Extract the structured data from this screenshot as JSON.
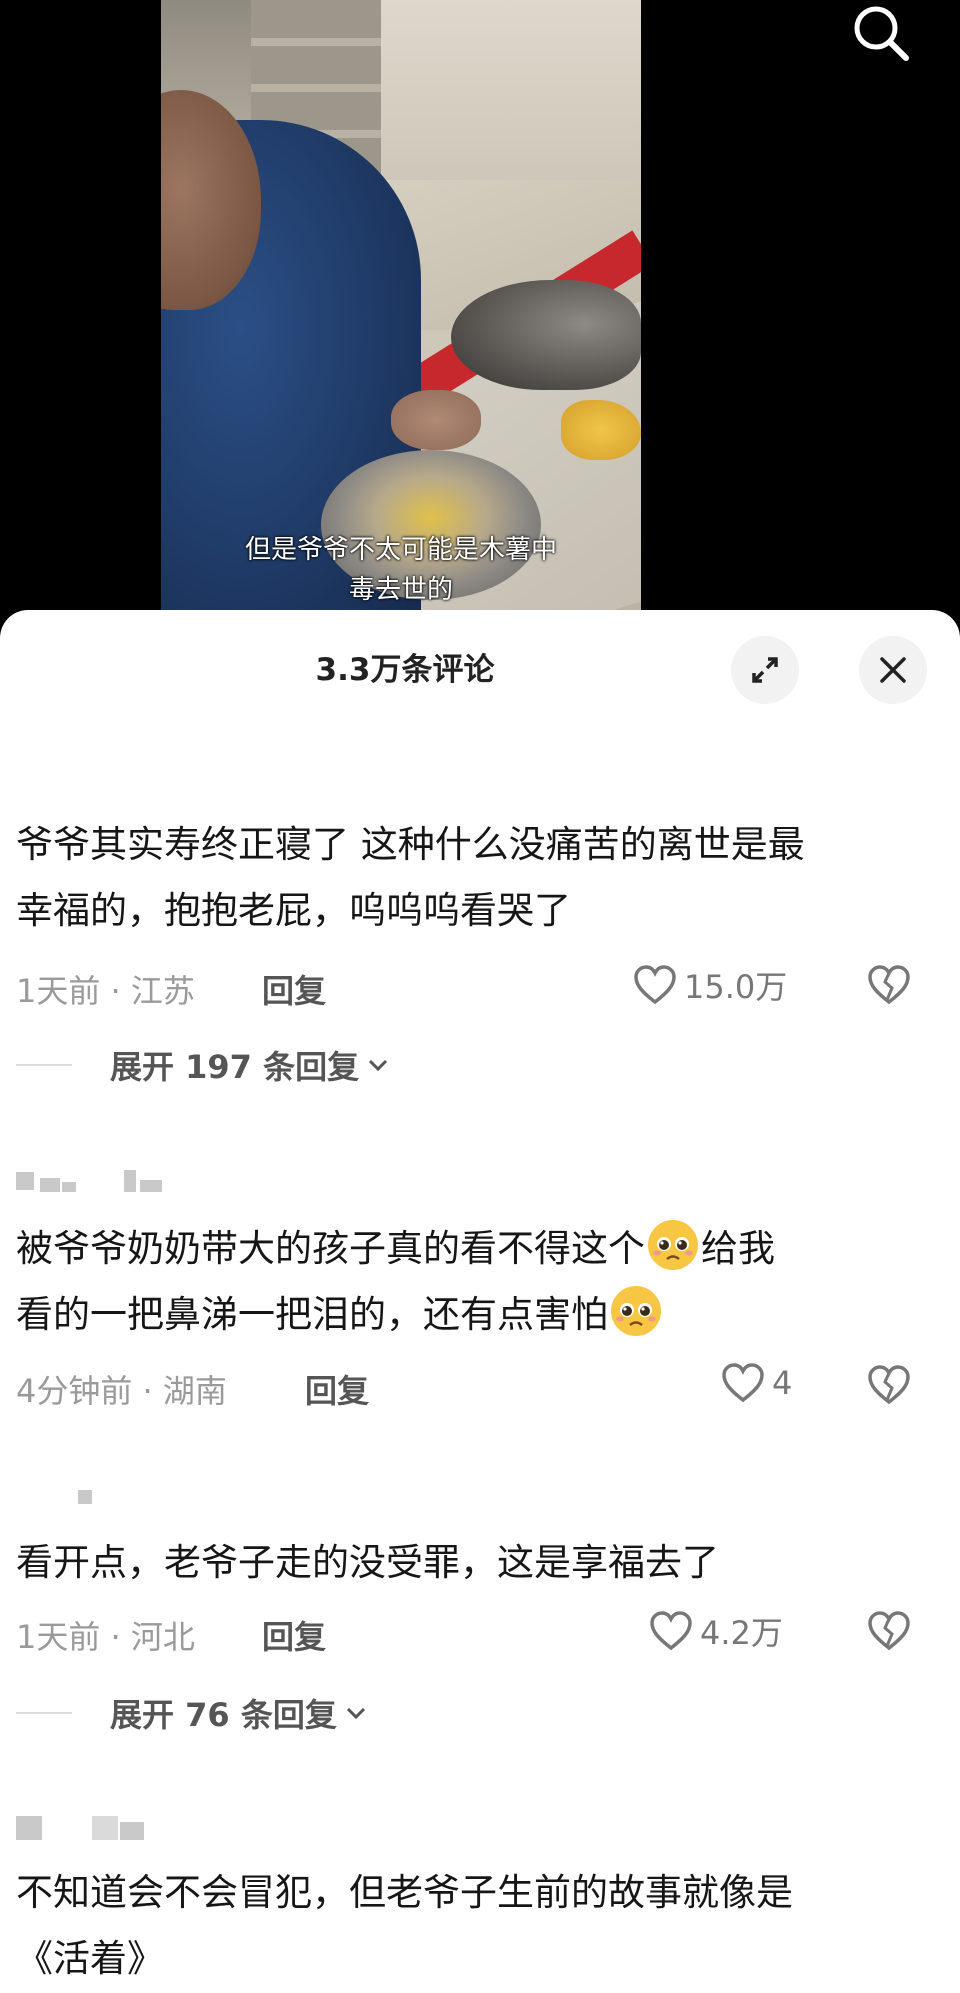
{
  "video": {
    "subtitle_line1": "但是爷爷不太可能是木薯中",
    "subtitle_line2": "毒去世的",
    "search_icon": "search-icon"
  },
  "sheet": {
    "title": "3.3万条评论",
    "expand_icon": "expand-icon",
    "close_icon": "close-icon"
  },
  "comments": [
    {
      "line1": "爷爷其实寿终正寝了 这种什么没痛苦的离世是最",
      "line2": "幸福的，抱抱老屁，呜呜呜看哭了",
      "time_location": "1天前 · 江苏",
      "reply_label": "回复",
      "likes": "15.0万",
      "expand_label": "展开 197 条回复"
    },
    {
      "line1_a": "被爷爷奶奶带大的孩子真的看不得这个",
      "line1_b": "给我",
      "line2": "看的一把鼻涕一把泪的，还有点害怕",
      "emoji": "pleading-face",
      "time_location": "4分钟前 · 湖南",
      "reply_label": "回复",
      "likes": "4"
    },
    {
      "line1": "看开点，老爷子走的没受罪，这是享福去了",
      "time_location": "1天前 · 河北",
      "reply_label": "回复",
      "likes": "4.2万",
      "expand_label": "展开 76 条回复"
    },
    {
      "line1": "不知道会不会冒犯，但老爷子生前的故事就像是",
      "line2": "《活着》"
    }
  ],
  "colors": {
    "accent_red": "#c7282d",
    "meta_gray": "#9a9a9a",
    "text": "#161616"
  }
}
